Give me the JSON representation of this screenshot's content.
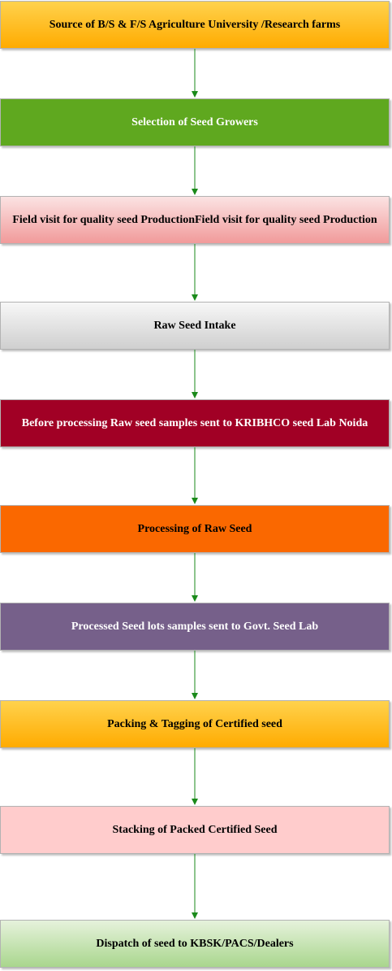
{
  "steps": [
    {
      "label": "Source of B/S & F/S Agriculture University /Research farms",
      "bg": "linear-gradient(#ffd24d,#ffab00)",
      "color": "#000000"
    },
    {
      "label": "Selection of Seed Growers",
      "bg": "#5fa81f",
      "color": "#ffffff"
    },
    {
      "label": "Field visit for quality seed ProductionField visit for quality seed Production",
      "bg": "linear-gradient(#fbe3e3,#f19a9a)",
      "color": "#000000"
    },
    {
      "label": "Raw Seed Intake",
      "bg": "linear-gradient(#f7f7f7,#cfcfcf)",
      "color": "#000000"
    },
    {
      "label": "Before processing Raw seed samples sent to KRIBHCO seed Lab Noida",
      "bg": "#a10025",
      "color": "#ffffff"
    },
    {
      "label": "Processing of Raw Seed",
      "bg": "#fa6800",
      "color": "#000000"
    },
    {
      "label": "Processed Seed lots samples sent to Govt. Seed Lab",
      "bg": "#76608a",
      "color": "#ffffff"
    },
    {
      "label": "Packing & Tagging of Certified seed",
      "bg": "linear-gradient(#ffd24d,#ffab00)",
      "color": "#000000"
    },
    {
      "label": "Stacking of Packed Certified Seed",
      "bg": "#ffcccc",
      "color": "#000000"
    },
    {
      "label": "Dispatch of seed to KBSK/PACS/Dealers",
      "bg": "linear-gradient(#e6f2dc,#a9d68d)",
      "color": "#000000"
    }
  ],
  "arrow_color": "#1a8a1a"
}
